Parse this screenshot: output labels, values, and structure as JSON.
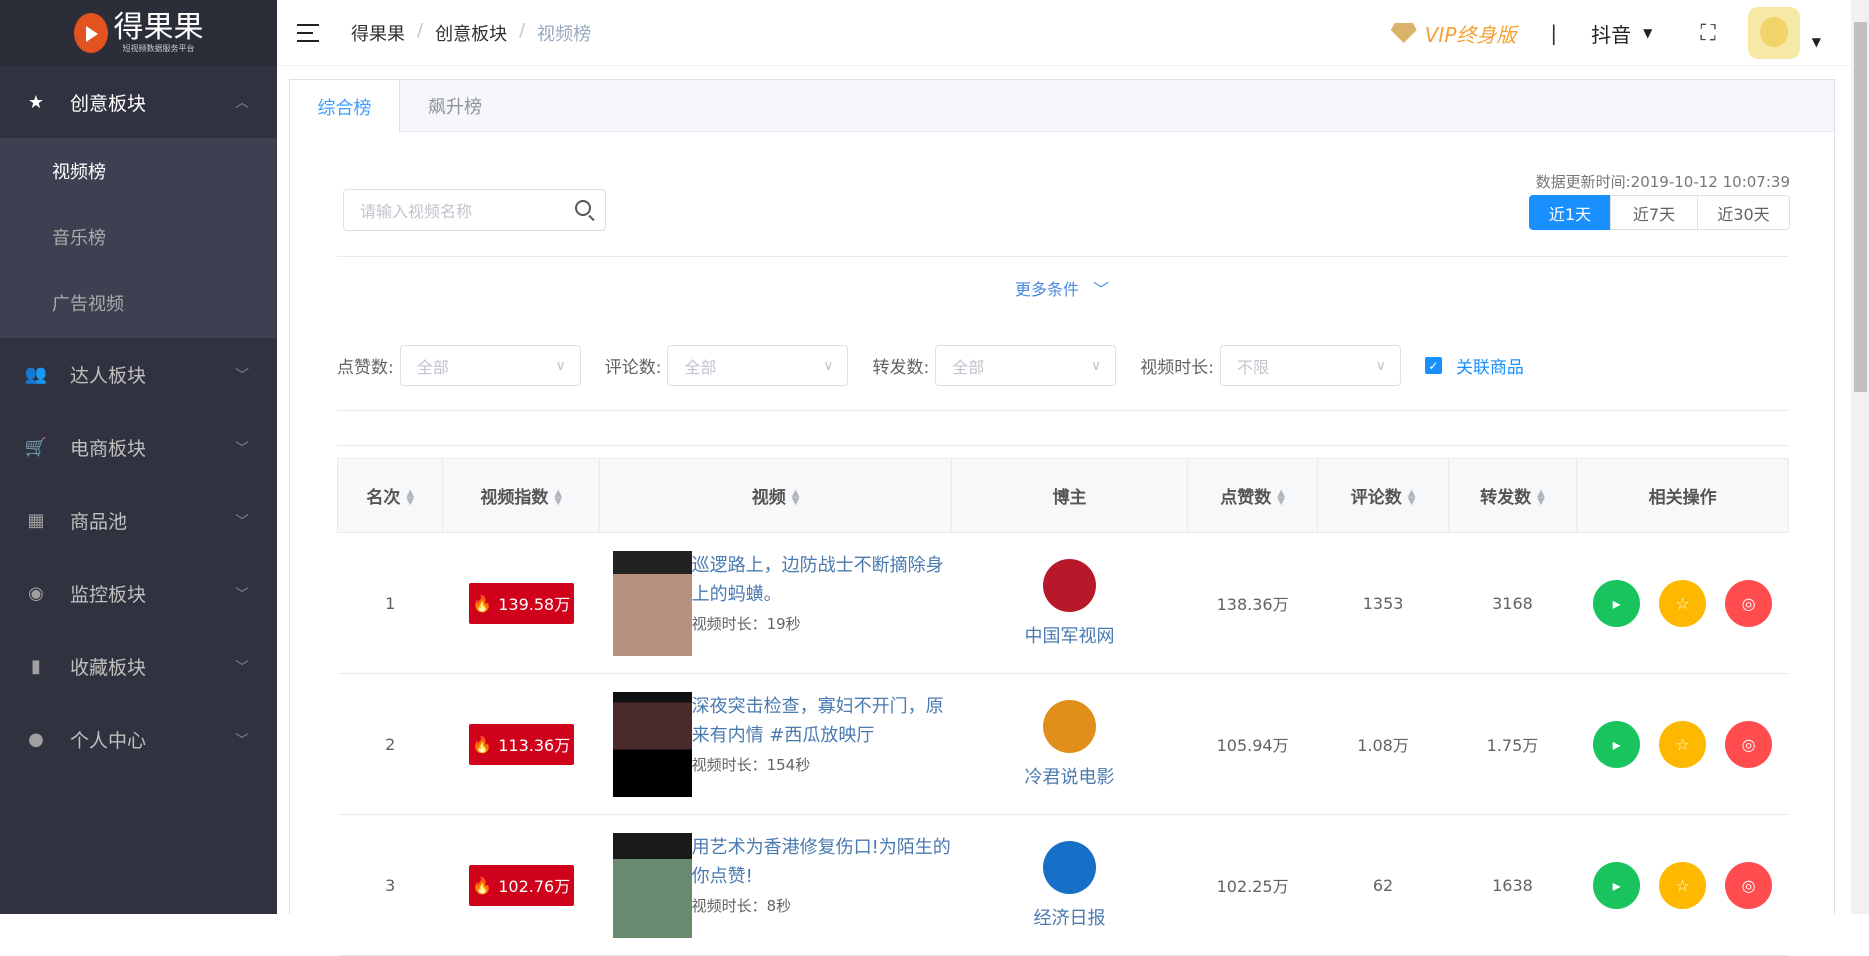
{
  "brand": {
    "name": "得果果",
    "tagline": "短视频数据服务平台"
  },
  "sidebar": {
    "open_group": {
      "label": "创意板块",
      "icon": "star-icon",
      "children": [
        {
          "label": "视频榜",
          "active": true
        },
        {
          "label": "音乐榜"
        },
        {
          "label": "广告视频"
        }
      ]
    },
    "groups": [
      {
        "label": "达人板块",
        "icon": "users-icon"
      },
      {
        "label": "电商板块",
        "icon": "cart-icon"
      },
      {
        "label": "商品池",
        "icon": "grid-icon"
      },
      {
        "label": "监控板块",
        "icon": "eye-icon"
      },
      {
        "label": "收藏板块",
        "icon": "book-icon"
      },
      {
        "label": "个人中心",
        "icon": "user-icon"
      }
    ]
  },
  "header": {
    "breadcrumb": [
      "得果果",
      "创意板块",
      "视频榜"
    ],
    "vip": "VIP终身版",
    "divider": "|",
    "platform": "抖音"
  },
  "tabs": [
    {
      "label": "综合榜",
      "active": true
    },
    {
      "label": "飙升榜"
    }
  ],
  "search": {
    "placeholder": "请输入视频名称",
    "value": ""
  },
  "update_time": "数据更新时间:2019-10-12 10:07:39",
  "range": [
    "近1天",
    "近7天",
    "近30天"
  ],
  "more": "更多条件",
  "filters": [
    {
      "label": "点赞数:",
      "value": "全部"
    },
    {
      "label": "评论数:",
      "value": "全部"
    },
    {
      "label": "转发数:",
      "value": "全部"
    },
    {
      "label": "视频时长:",
      "value": "不限"
    }
  ],
  "related_goods": {
    "label": "关联商品",
    "checked": true
  },
  "table": {
    "headers": [
      "名次",
      "视频指数",
      "视频",
      "博主",
      "点赞数",
      "评论数",
      "转发数",
      "相关操作"
    ],
    "rows": [
      {
        "rank": "1",
        "index": "139.58万",
        "title": "巡逻路上，边防战士不断摘除身上的蚂蟥。",
        "duration": "视频时长：19秒",
        "blogger": "中国军视网",
        "likes": "138.36万",
        "comments": "1353",
        "shares": "3168"
      },
      {
        "rank": "2",
        "index": "113.36万",
        "title": "深夜突击检查，寡妇不开门，原来有内情 #西瓜放映厅",
        "duration": "视频时长：154秒",
        "blogger": "冷君说电影",
        "likes": "105.94万",
        "comments": "1.08万",
        "shares": "1.75万"
      },
      {
        "rank": "3",
        "index": "102.76万",
        "title": "用艺术为香港修复伤口!为陌生的你点赞!",
        "duration": "视频时长：8秒",
        "blogger": "经济日报",
        "likes": "102.25万",
        "comments": "62",
        "shares": "1638"
      }
    ]
  },
  "colors": {
    "accent": "#1890ff",
    "heat": "#d0021b",
    "play": "#19c45f",
    "star": "#ffb800",
    "view": "#ff4d4f",
    "sidebar": "#30333f"
  }
}
